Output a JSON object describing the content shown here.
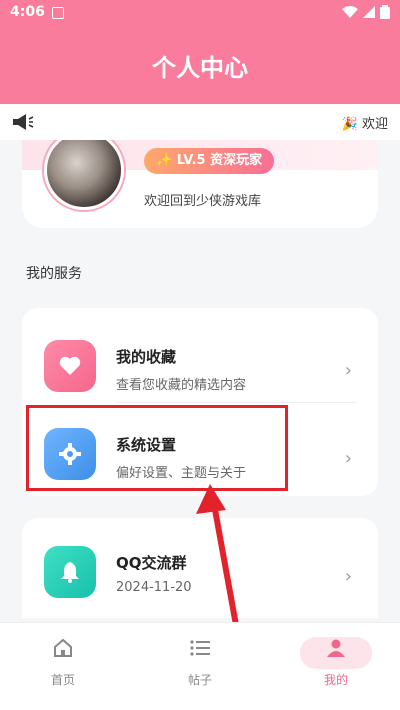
{
  "status_bar": {
    "time": "4:06"
  },
  "header": {
    "title": "个人中心"
  },
  "notice": {
    "text": "欢迎"
  },
  "profile": {
    "level_badge": "✨ LV.5 资深玩家",
    "welcome": "欢迎回到少侠游戏库"
  },
  "services": {
    "section_title": "我的服务",
    "items": [
      {
        "title": "我的收藏",
        "subtitle": "查看您收藏的精选内容",
        "icon": "heart-icon",
        "color": "#f86c8e"
      },
      {
        "title": "系统设置",
        "subtitle": "偏好设置、主题与关于",
        "icon": "gear-icon",
        "color": "#4da1f5"
      }
    ]
  },
  "qq_group": {
    "title": "QQ交流群",
    "date": "2024-11-20",
    "icon": "bell-icon",
    "color": "#1fcfb6"
  },
  "bottom_nav": [
    {
      "label": "首页",
      "icon": "home-icon"
    },
    {
      "label": "帖子",
      "icon": "list-icon"
    },
    {
      "label": "我的",
      "icon": "user-icon",
      "active": true
    }
  ],
  "colors": {
    "brand": "#f97c9c",
    "annotation": "#e2232b"
  }
}
